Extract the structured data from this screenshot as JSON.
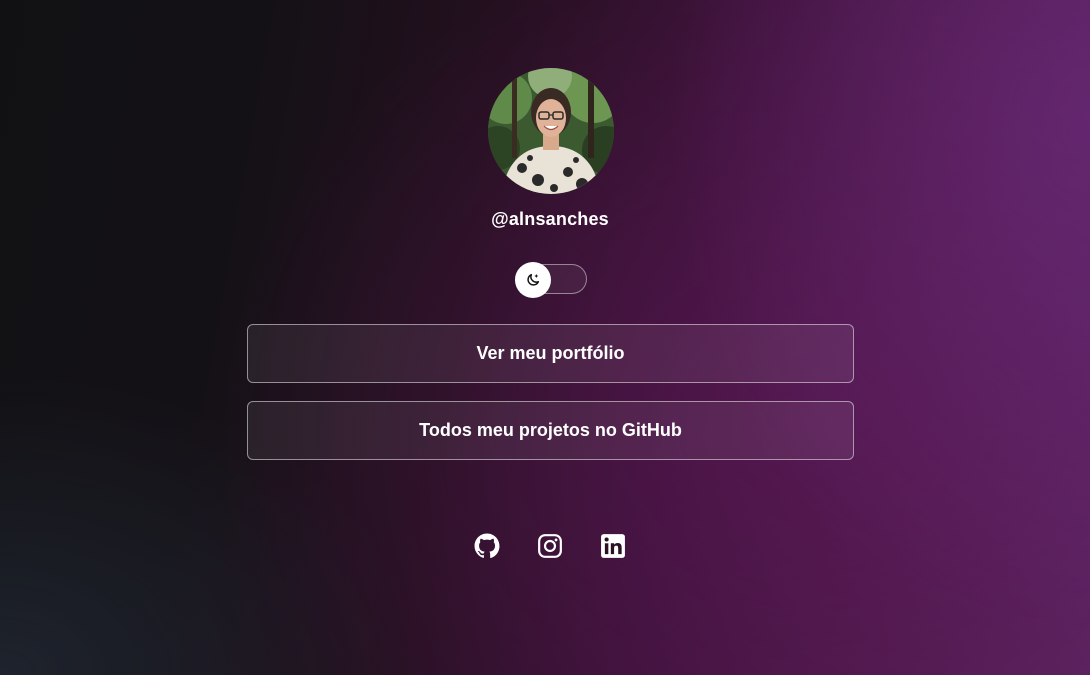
{
  "profile": {
    "username": "@alnsanches",
    "avatar_icon": "profile-photo"
  },
  "theme_toggle": {
    "icon": "moon-icon",
    "state": "light"
  },
  "links": [
    {
      "label": "Ver meu portfólio"
    },
    {
      "label": "Todos meu projetos no GitHub"
    }
  ],
  "social": [
    {
      "icon": "github-icon"
    },
    {
      "icon": "instagram-icon"
    },
    {
      "icon": "linkedin-icon"
    }
  ],
  "colors": {
    "text": "#ffffff",
    "background_left": "#111114",
    "background_right": "#5a2460"
  }
}
